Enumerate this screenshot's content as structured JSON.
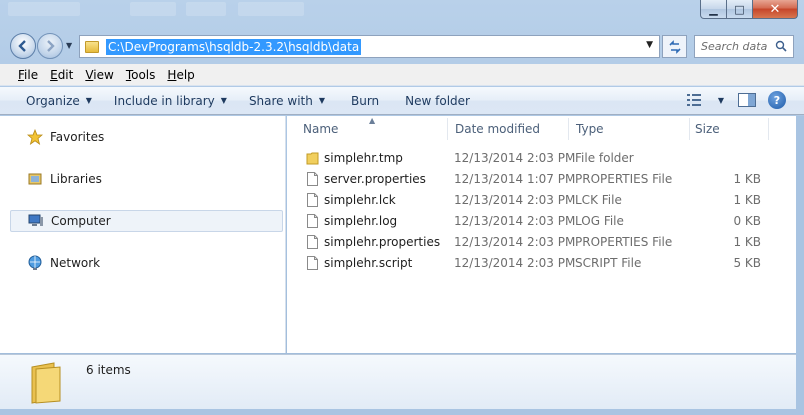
{
  "window": {
    "address_path": "C:\\DevPrograms\\hsqldb-2.3.2\\hsqldb\\data",
    "search_placeholder": "Search data",
    "minimize_glyph": "▁",
    "maximize_glyph": "□",
    "close_glyph": "✕"
  },
  "menubar": {
    "items": [
      {
        "u": "F",
        "rest": "ile"
      },
      {
        "u": "E",
        "rest": "dit"
      },
      {
        "u": "V",
        "rest": "iew"
      },
      {
        "u": "T",
        "rest": "ools"
      },
      {
        "u": "H",
        "rest": "elp"
      }
    ]
  },
  "commandbar": {
    "organize": "Organize",
    "include_in_library": "Include in library",
    "share_with": "Share with",
    "burn": "Burn",
    "new_folder": "New folder",
    "help_glyph": "?"
  },
  "navpane": {
    "favorites": "Favorites",
    "libraries": "Libraries",
    "computer": "Computer",
    "network": "Network"
  },
  "filelist": {
    "columns": {
      "name": "Name",
      "date_modified": "Date modified",
      "type": "Type",
      "size": "Size"
    },
    "rows": [
      {
        "name": "simplehr.tmp",
        "date": "12/13/2014 2:03 PM",
        "type": "File folder",
        "size": "",
        "icon": "folder-icon"
      },
      {
        "name": "server.properties",
        "date": "12/13/2014 1:07 PM",
        "type": "PROPERTIES File",
        "size": "1 KB",
        "icon": "file-icon"
      },
      {
        "name": "simplehr.lck",
        "date": "12/13/2014 2:03 PM",
        "type": "LCK File",
        "size": "1 KB",
        "icon": "file-icon"
      },
      {
        "name": "simplehr.log",
        "date": "12/13/2014 2:03 PM",
        "type": "LOG File",
        "size": "0 KB",
        "icon": "file-icon"
      },
      {
        "name": "simplehr.properties",
        "date": "12/13/2014 2:03 PM",
        "type": "PROPERTIES File",
        "size": "1 KB",
        "icon": "file-icon"
      },
      {
        "name": "simplehr.script",
        "date": "12/13/2014 2:03 PM",
        "type": "SCRIPT File",
        "size": "5 KB",
        "icon": "file-icon"
      }
    ]
  },
  "details": {
    "item_count": "6 items"
  }
}
